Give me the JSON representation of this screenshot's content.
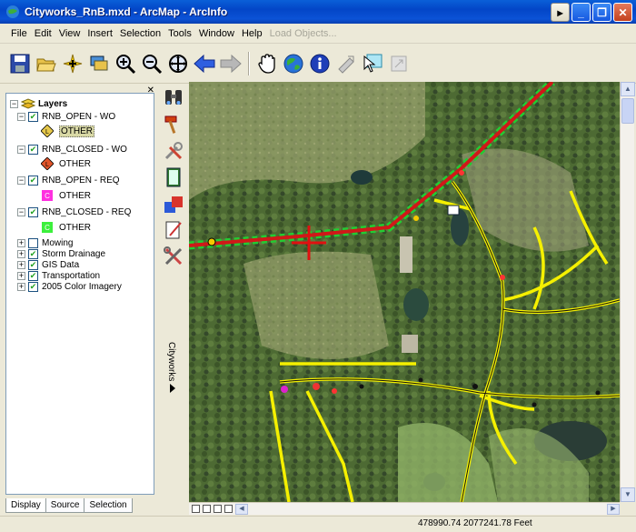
{
  "window": {
    "title": "Cityworks_RnB.mxd - ArcMap - ArcInfo",
    "controls": [
      "minimize",
      "restore",
      "close"
    ]
  },
  "menu": {
    "items": [
      "File",
      "Edit",
      "View",
      "Insert",
      "Selection",
      "Tools",
      "Window",
      "Help"
    ],
    "load_objects": "Load Objects..."
  },
  "toolbar": {
    "buttons": [
      "save-icon",
      "open-icon",
      "add-data-icon",
      "layer-icon",
      "zoom-in-icon",
      "zoom-out-icon",
      "fixed-zoom-icon",
      "back-arrow-icon",
      "forward-arrow-icon",
      "pan-hand-icon",
      "globe-full-extent-icon",
      "identify-icon",
      "edit-pointer-icon",
      "select-elements-icon",
      "disabled-tool-icon"
    ]
  },
  "toc": {
    "root": "Layers",
    "groups": [
      {
        "name": "RNB_OPEN - WO",
        "symbol_label": "OTHER",
        "symbol_color": "#e6c84a",
        "selected": true
      },
      {
        "name": "RNB_CLOSED - WO",
        "symbol_label": "OTHER",
        "symbol_color": "#e0542a",
        "selected": false
      },
      {
        "name": "RNB_OPEN - REQ",
        "symbol_label": "OTHER",
        "symbol_color": "#ff2fe0",
        "selected": false
      },
      {
        "name": "RNB_CLOSED - REQ",
        "symbol_label": "OTHER",
        "symbol_color": "#3cf03c",
        "selected": false
      }
    ],
    "layers": [
      {
        "name": "Mowing",
        "checked": false
      },
      {
        "name": "Storm Drainage",
        "checked": true
      },
      {
        "name": "GIS Data",
        "checked": true
      },
      {
        "name": "Transportation",
        "checked": true
      },
      {
        "name": "2005 Color Imagery",
        "checked": true
      }
    ],
    "tabs": [
      "Display",
      "Source",
      "Selection"
    ]
  },
  "cityworks": {
    "label": "Cityworks",
    "buttons": [
      "binoculars-icon",
      "hammer-icon",
      "tools-icon",
      "book-icon",
      "chart-icon",
      "edit-list-icon",
      "wrench-crossed-icon"
    ]
  },
  "status": {
    "coordinates": "478990.74  2077241.78 Feet"
  },
  "colors": {
    "xp_blue": "#0a5fd8",
    "road_yellow": "#f5f000",
    "pipe_red": "#d01818",
    "pipe_green": "#22cc33"
  }
}
